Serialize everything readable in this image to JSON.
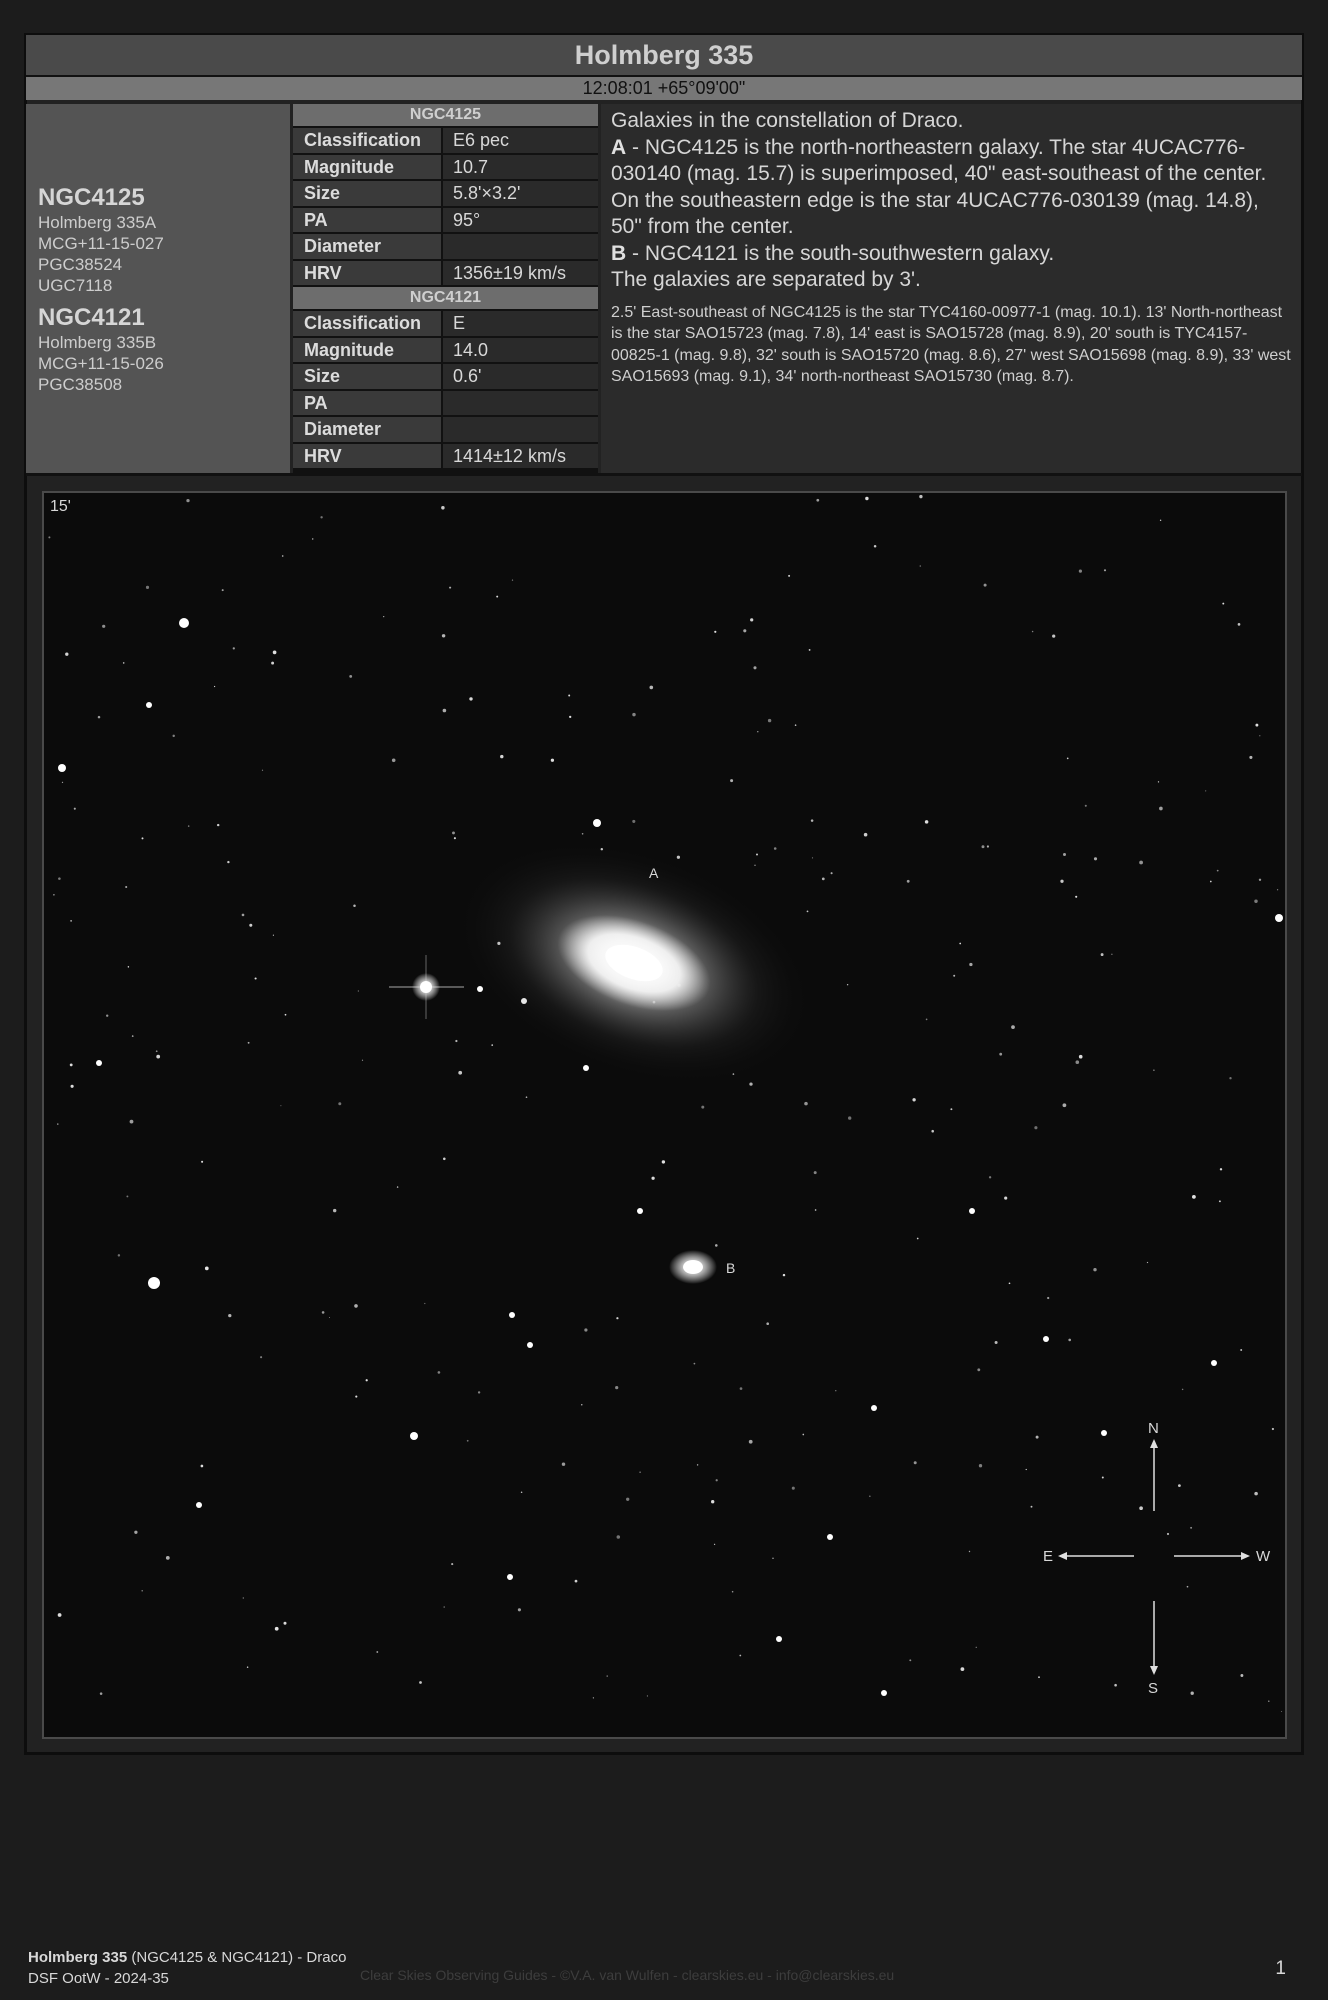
{
  "header": {
    "title": "Holmberg 335",
    "coordinates": "12:08:01 +65°09'00\""
  },
  "objects": [
    {
      "name": "NGC4125",
      "aliases": [
        "Holmberg 335A",
        "MCG+11-15-027",
        "PGC38524",
        "UGC7118"
      ]
    },
    {
      "name": "NGC4121",
      "aliases": [
        "Holmberg 335B",
        "MCG+11-15-026",
        "PGC38508"
      ]
    }
  ],
  "tables": [
    {
      "title": "NGC4125",
      "rows": [
        {
          "key": "Classification",
          "value": "E6 pec"
        },
        {
          "key": "Magnitude",
          "value": "10.7"
        },
        {
          "key": "Size",
          "value": "5.8'×3.2'"
        },
        {
          "key": "PA",
          "value": "95°"
        },
        {
          "key": "Diameter",
          "value": ""
        },
        {
          "key": "HRV",
          "value": "1356±19 km/s"
        }
      ]
    },
    {
      "title": "NGC4121",
      "rows": [
        {
          "key": "Classification",
          "value": "E"
        },
        {
          "key": "Magnitude",
          "value": "14.0"
        },
        {
          "key": "Size",
          "value": "0.6'"
        },
        {
          "key": "PA",
          "value": ""
        },
        {
          "key": "Diameter",
          "value": ""
        },
        {
          "key": "HRV",
          "value": "1414±12 km/s"
        }
      ]
    }
  ],
  "description": {
    "intro": "Galaxies in the constellation of Draco.",
    "a_label": "A",
    "a_text": " - NGC4125 is the north-northeastern galaxy. The star 4UCAC776-030140 (mag. 15.7) is superimposed, 40\" east-southeast of the center. On the southeastern edge is the star 4UCAC776-030139 (mag. 14.8), 50\" from the center.",
    "b_label": "B",
    "b_text": " - NGC4121 is the south-southwestern galaxy.",
    "separation": "The galaxies are separated by 3'.",
    "notes": "2.5' East-southeast of NGC4125 is the star TYC4160-00977-1 (mag. 10.1). 13' North-northeast is the star SAO15723 (mag. 7.8), 14' east is SAO15728 (mag. 8.9), 20' south is TYC4157-00825-1 (mag. 9.8), 32' south is SAO15720 (mag. 8.6), 27' west SAO15698 (mag. 8.9), 33' west SAO15693 (mag. 9.1), 34' north-northeast SAO15730 (mag. 8.7)."
  },
  "image": {
    "scale_label": "15'",
    "marker_a": "A",
    "marker_b": "B",
    "compass": {
      "n": "N",
      "s": "S",
      "e": "E",
      "w": "W"
    }
  },
  "footer": {
    "title_bold": "Holmberg 335",
    "title_rest": " (NGC4125 & NGC4121) - Draco",
    "series": "DSF OotW - 2024-35",
    "credit": "Clear Skies Observing Guides - ©V.A. van Wulfen - clearskies.eu - info@clearskies.eu",
    "page": "1"
  }
}
